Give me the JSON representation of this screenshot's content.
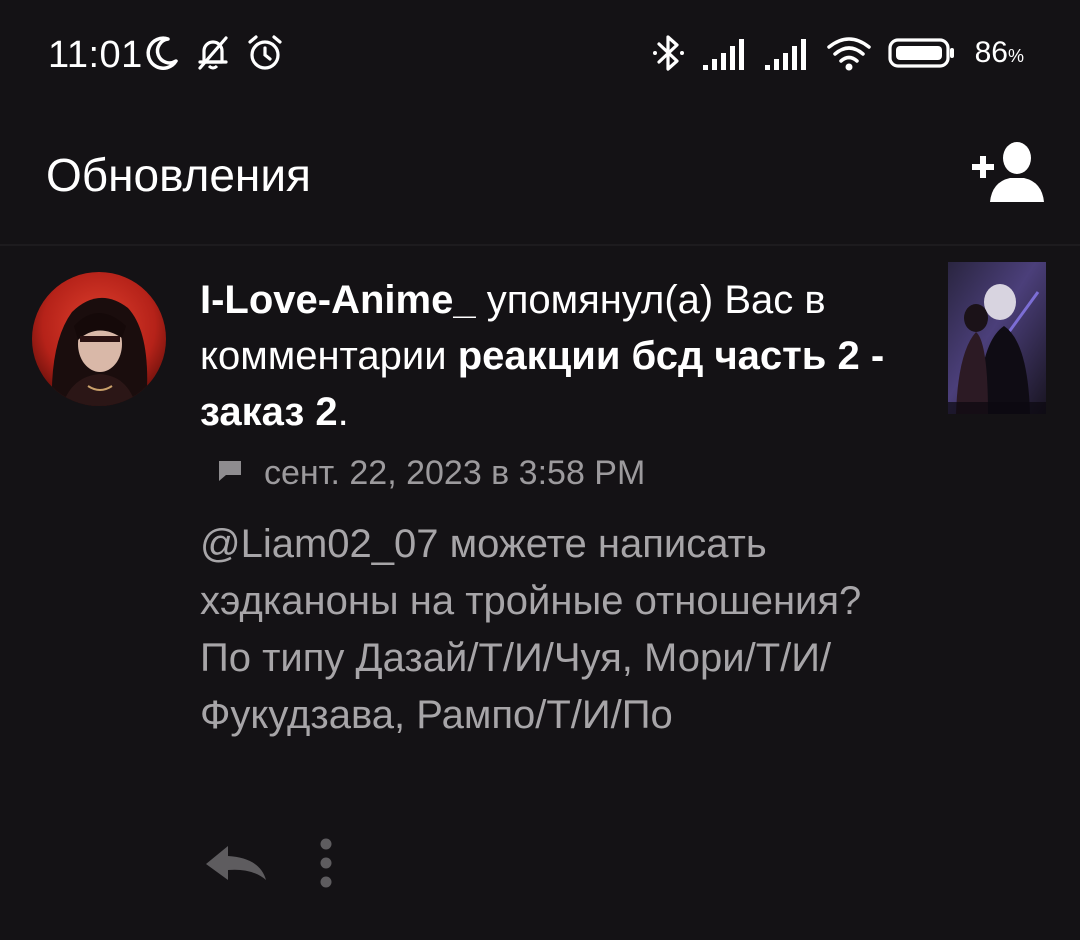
{
  "status_bar": {
    "time": "11:01",
    "battery_percent": "86",
    "battery_unit": "%",
    "left_icons": [
      "moon-icon",
      "bell-off-icon",
      "alarm-icon"
    ],
    "right_icons": [
      "bluetooth-icon",
      "signal-icon",
      "signal-icon",
      "wifi-icon",
      "battery-icon"
    ]
  },
  "header": {
    "title": "Обновления",
    "add_user_icon": "add-user-icon"
  },
  "notification": {
    "username": "I-Love-Anime_",
    "action": " упомянул(а) Вас в комментарии ",
    "story_title": "реакции бсд часть 2 - заказ 2",
    "period": ".",
    "date": "сент. 22, 2023 в 3:58 PM",
    "comment": "@Liam02_07 можете написать хэдканоны на тройные отношения? По типу Дазай/Т/И/Чуя, Мори/Т/И/Фукудзава, Рампо/Т/И/По",
    "reply_icon": "reply-icon",
    "more_icon": "more-vertical-icon"
  },
  "colors": {
    "background": "#141215",
    "text_primary": "#ffffff",
    "text_secondary": "#a7a5a8",
    "text_meta": "#9c9a9d"
  }
}
